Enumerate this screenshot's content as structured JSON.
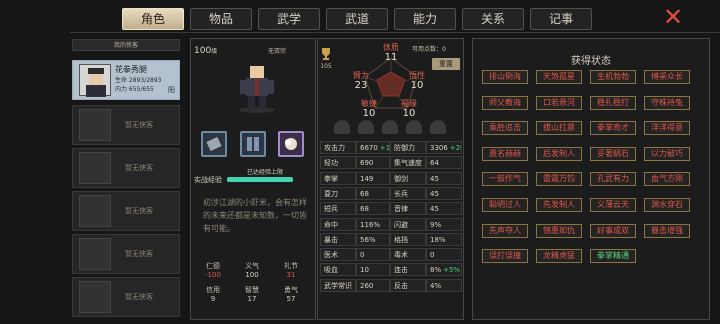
{
  "tabs": [
    {
      "label": "角色",
      "active": true
    },
    {
      "label": "物品"
    },
    {
      "label": "武学"
    },
    {
      "label": "武道"
    },
    {
      "label": "能力"
    },
    {
      "label": "关系"
    },
    {
      "label": "记事"
    }
  ],
  "sidebar": {
    "title": "我的侠客",
    "hero": {
      "name": "花拳秀腿",
      "life": "生命 2893/2893",
      "inner": "内力 655/655",
      "tag": "阳"
    },
    "empty_label": "暂无侠客"
  },
  "character": {
    "level": "100",
    "level_unit": "级",
    "school": "无双宗",
    "exp_label": "实战经验",
    "exp_tag": "已达经验上限",
    "exp_fraction": 1.0,
    "description": "初涉江湖的小虾米，会有怎样的未来还都是未知数，一切皆有可能。",
    "virtues": [
      {
        "name": "仁德",
        "value": "-100"
      },
      {
        "name": "义气",
        "value": "100"
      },
      {
        "name": "礼节",
        "value": "31"
      },
      {
        "name": "信用",
        "value": "9"
      },
      {
        "name": "智慧",
        "value": "17"
      },
      {
        "name": "勇气",
        "value": "57"
      }
    ]
  },
  "attributes": {
    "potential": "可用点数：0",
    "reset": "重置",
    "total": "105",
    "items": [
      {
        "name": "体质",
        "value": "11"
      },
      {
        "name": "臂力",
        "value": "23"
      },
      {
        "name": "悟性",
        "value": "10"
      },
      {
        "name": "敏捷",
        "value": "10"
      },
      {
        "name": "福缘",
        "value": "10"
      }
    ]
  },
  "stats": [
    [
      {
        "name": "攻击力",
        "value": "6670",
        "bonus": "+197"
      },
      {
        "name": "防御力",
        "value": "3306",
        "bonus": "+202"
      }
    ],
    [
      {
        "name": "轻功",
        "value": "690"
      },
      {
        "name": "集气速度",
        "value": "64"
      }
    ],
    [
      {
        "name": "拳掌",
        "value": "149"
      },
      {
        "name": "御剑",
        "value": "45"
      }
    ],
    [
      {
        "name": "耍刀",
        "value": "68"
      },
      {
        "name": "长兵",
        "value": "45"
      }
    ],
    [
      {
        "name": "短兵",
        "value": "68"
      },
      {
        "name": "音律",
        "value": "45"
      }
    ],
    [
      {
        "name": "命中",
        "value": "116%"
      },
      {
        "name": "闪避",
        "value": "9%"
      }
    ],
    [
      {
        "name": "暴击",
        "value": "56%"
      },
      {
        "name": "格挡",
        "value": "18%"
      }
    ],
    [
      {
        "name": "医术",
        "value": "0"
      },
      {
        "name": "毒术",
        "value": "0"
      }
    ],
    [
      {
        "name": "吸血",
        "value": "10"
      },
      {
        "name": "连击",
        "value": "8%",
        "bonus": "+5%"
      }
    ],
    [
      {
        "name": "武学常识",
        "value": "260"
      },
      {
        "name": "反击",
        "value": "4%"
      }
    ]
  ],
  "status": {
    "title": "获得状态",
    "badges": [
      [
        "排山倒海",
        "天煞孤星",
        "生机勃勃",
        "傅采众长"
      ],
      [
        "师父教诲",
        "口若悬河",
        "稳扎稳打",
        "守株待兔"
      ],
      [
        "乘胜追击",
        "拔山扛鼎",
        "拳掌奇才",
        "洋洋得意"
      ],
      [
        "愚名赫赫",
        "后发制人",
        "妥著蜗石",
        "以力破巧"
      ],
      [
        "一鼓作气",
        "雷霆万钧",
        "孔武有力",
        "血气方刚"
      ],
      [
        "聪明过人",
        "先发制人",
        "义薄云天",
        "渊水穿石"
      ],
      [
        "先声夺人",
        "锦惠如仇",
        "好事成双",
        "暴击增强"
      ],
      [
        "误打误撞",
        "龙精虎猛",
        "拳掌精通"
      ]
    ]
  }
}
